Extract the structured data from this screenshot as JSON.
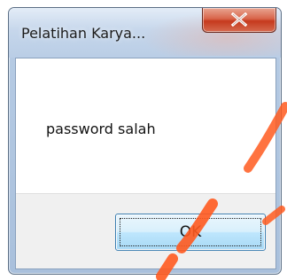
{
  "dialog": {
    "title": "Pelatihan Karya...",
    "message": "password salah",
    "ok_label": "OK",
    "close_icon": "close-icon"
  },
  "colors": {
    "frame": "#a9c0dc",
    "close_button": "#c5391d",
    "ok_button_border": "#3c7fb1",
    "watermark": "#ff5a1f"
  }
}
